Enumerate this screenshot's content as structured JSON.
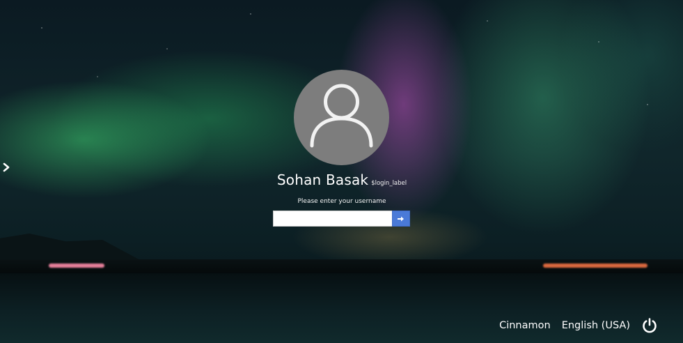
{
  "login": {
    "user_name": "Sohan Basak",
    "login_label": "$login_label",
    "prompt": "Please enter your username",
    "username_value": ""
  },
  "bottom_bar": {
    "session": "Cinnamon",
    "language": "English (USA)"
  },
  "icons": {
    "avatar": "user-silhouette-icon",
    "submit": "arrow-right-icon",
    "side": "chevron-right-icon",
    "power": "power-icon"
  },
  "colors": {
    "submit_button": "#4a7ad8",
    "avatar_bg": "#7d7d7d"
  }
}
